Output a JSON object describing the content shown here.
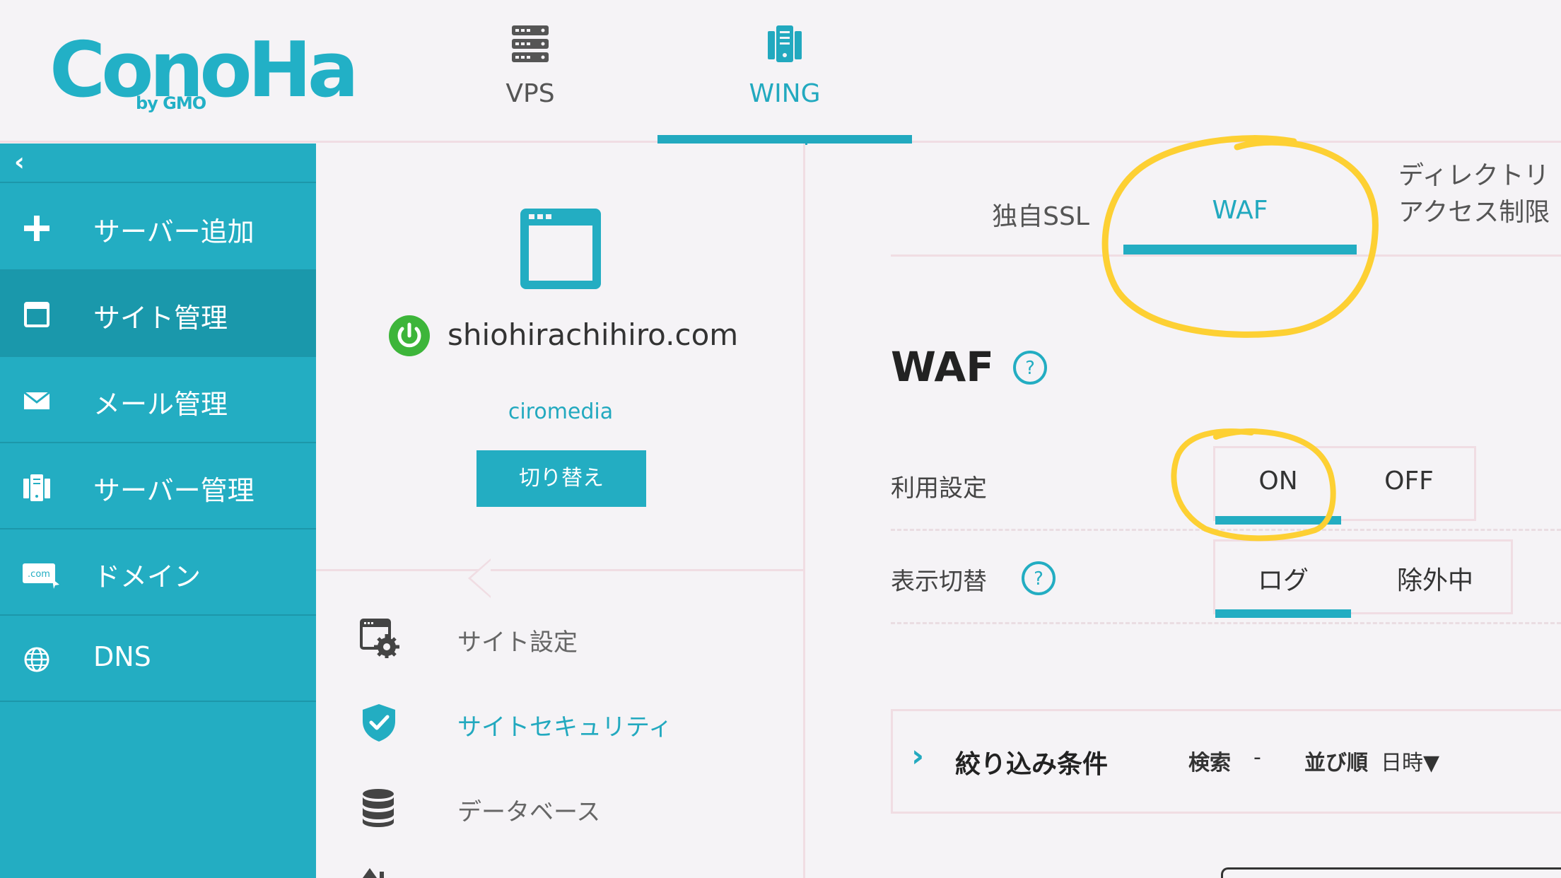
{
  "header": {
    "logo_text": "ConoHa",
    "logo_sub": "by GMO",
    "tabs": [
      {
        "label": "VPS",
        "icon": "server-stack-icon",
        "active": false
      },
      {
        "label": "WING",
        "icon": "wing-server-icon",
        "active": true
      }
    ]
  },
  "sidebar": {
    "collapse_icon": "chevron-left-icon",
    "items": [
      {
        "label": "サーバー追加",
        "icon": "plus-icon",
        "active": false
      },
      {
        "label": "サイト管理",
        "icon": "window-icon",
        "active": true
      },
      {
        "label": "メール管理",
        "icon": "envelope-icon",
        "active": false
      },
      {
        "label": "サーバー管理",
        "icon": "server-icon",
        "active": false
      },
      {
        "label": "ドメイン",
        "icon": "dotcom-icon",
        "active": false
      },
      {
        "label": "DNS",
        "icon": "globe-icon",
        "active": false
      }
    ]
  },
  "site": {
    "domain": "shiohirachihiro.com",
    "account": "ciromedia",
    "switch_label": "切り替え",
    "status_color": "#3db53a"
  },
  "site_menu": [
    {
      "label": "サイト設定",
      "icon": "site-settings-icon",
      "active": false
    },
    {
      "label": "サイトセキュリティ",
      "icon": "shield-check-icon",
      "active": true
    },
    {
      "label": "データベース",
      "icon": "database-icon",
      "active": false
    }
  ],
  "security_tabs": [
    {
      "label": "独自SSL",
      "active": false
    },
    {
      "label": "WAF",
      "active": true
    },
    {
      "label_line1": "ディレクトリ",
      "label_line2": "アクセス制限",
      "active": false
    }
  ],
  "waf": {
    "title": "WAF",
    "usage_label": "利用設定",
    "usage_options": [
      "ON",
      "OFF"
    ],
    "usage_selected": "ON",
    "display_label": "表示切替",
    "display_options": [
      "ログ",
      "除外中"
    ],
    "display_selected": "ログ"
  },
  "filter": {
    "title": "絞り込み条件",
    "search_label": "検索",
    "search_value": "-",
    "sort_label": "並び順",
    "sort_value": "日時▼"
  },
  "colors": {
    "accent": "#23adc2",
    "sidebar_bg": "#23adc2",
    "sidebar_active": "#1a98ab",
    "annotation": "#fdd033"
  }
}
